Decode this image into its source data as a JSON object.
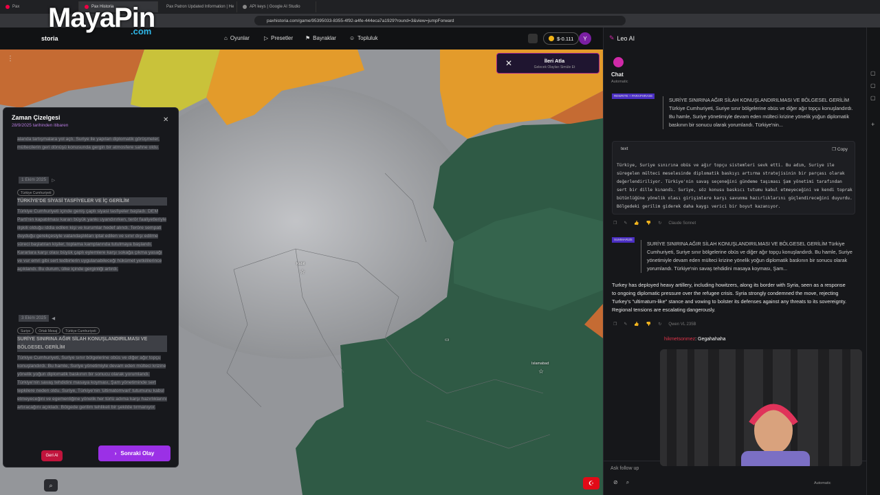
{
  "browser": {
    "tabs": [
      "Pax",
      "Pax Historia",
      "Pax Patron Updated Information | He",
      "API keys | Google AI Studio"
    ],
    "url": "paxhistoria.com/game/95395033-8355-4f92-a4fe-444eca7a1929?round=3&view=jumpForward"
  },
  "header": {
    "brand": "storia",
    "nav": [
      {
        "icon": "gamepad-icon",
        "label": "Oyunlar"
      },
      {
        "icon": "play-icon",
        "label": "Presetler"
      },
      {
        "icon": "flag-icon",
        "label": "Bayraklar"
      },
      {
        "icon": "users-icon",
        "label": "Topluluk"
      }
    ],
    "balance": "$-0.111",
    "avatar": "Y"
  },
  "watermark": {
    "text": "MayaPin",
    "suffix": ".com"
  },
  "toast": {
    "close": "✕",
    "title": "İleri Atla",
    "subtitle": "Gelecek Olayları Simüle Et"
  },
  "map_labels": [
    {
      "text": "Kabil"
    },
    {
      "text": "Islamabad"
    }
  ],
  "timeline": {
    "title": "Zaman Çizelgesi",
    "subtitle": "28/9/2025 tarihinden itibaren",
    "close": "✕",
    "intro_text": "alanda tartışmalara yol açtı. Suriye ile yapılan diplomatik görüşmeler, mültecilerin geri dönüşü konusunda gergin bir atmosfere sahne oldu.",
    "events": [
      {
        "date": "1 Ekim 2025",
        "chips": [
          "Türkiye Cumhuriyeti"
        ],
        "title": "TÜRKİYE'DE SİYASİ TASFİYELER VE İÇ GERİLİM",
        "body": "Türkiye Cumhuriyeti içinde geniş çaplı siyasi tasfiyeler başladı. DEM Parti'nin kapatılması kararı büyük yankı uyandırırken, terör faaliyetleriyle ilişkili olduğu iddia edilen kişi ve kurumlar hedef alındı. Teröre sempati duyduğu gerekçesiyle vatandaşlıkları iptal edilen ve sınır dışı edilme süreci başlatılan kişiler, toplama kamplarında tutulmaya başlandı. Kararlara karşı olası büyük çaplı eylemlere karşı sokağa çıkma yasağı ve vur emri gibi sert tedbirlerin uygulanabileceği hükümet yetkililerince açıklandı. Bu durum, ülke içinde gerginliği artırdı."
      },
      {
        "date": "3 Ekim 2025",
        "chips": [
          "Suriye",
          "Ortak Mesaj",
          "Türkiye Cumhuriyeti"
        ],
        "title": "SURİYE SINIRINA AĞIR SİLAH KONUŞLANDIRILMASI VE BÖLGESEL GERİLİM",
        "body": "Türkiye Cumhuriyeti, Suriye sınır bölgelerine obüs ve diğer ağır topçu konuşlandırdı. Bu hamle, Suriye yönetimiyle devam eden mülteci krizine yönelik yoğun diplomatik baskının bir sonucu olarak yorumlandı. Türkiye'nin savaş tehdidini masaya koyması, Şam yönetiminde sert tepkilere neden oldu. Suriye, Türkiye'nin 'ültimatomvari' tutumunu kabul etmeyeceğini ve egemenliğine yönelik her türlü adıma karşı hazırlıklarını artıracağını açıkladı. Bölgede gerilim tehlikeli bir şekilde tırmanıyor."
      }
    ],
    "prev_label": "Geri Al",
    "next_label": "Sonraki Olay"
  },
  "ai_panel": {
    "title": "Leo AI",
    "chat_label": "Chat",
    "mode": "Automatic",
    "tag1": "REWRITE + PARAPHRASE",
    "quote1": "SURİYE SINIRINA AĞIR SİLAH KONUŞLANDIRILMASI VE BÖLGESEL GERİLİM Türkiye Cumhuriyeti, Suriye sınır bölgelerine obüs ve diğer ağır topçu konuşlandırdı. Bu hamle, Suriye yönetimiyle devam eden mülteci krizine yönelik yoğun diplomatik baskının bir sonucu olarak yorumlandı. Türkiye'nin...",
    "code_header": "text",
    "copy_label": "Copy",
    "code_body": "Türkiye, Suriye sınırına obüs ve ağır topçu sistemleri sevk etti. Bu adım, Suriye ile süregelen mülteci meselesinde diplomatik baskıyı artırma stratejisinin bir parçası olarak değerlendiriliyor. Türkiye'nin savaş seçeneğini gündeme taşıması Şam yönetimi tarafından sert bir dille kınandı. Suriye, söz konusu baskıcı tutumu kabul etmeyeceğini ve kendi toprak bütünlüğüne yönelik olası girişimlere karşı savunma hazırlıklarını güçlendireceğini duyurdu. Bölgedeki gerilim giderek daha kaygı verici bir boyut kazanıyor.",
    "model1": "Claude Sonnet",
    "tag2": "SUMMARIZE",
    "quote2": "SURİYE SINIRINA AĞIR SİLAH KONUŞLANDIRILMASI VE BÖLGESEL GERİLİM Türkiye Cumhuriyeti, Suriye sınır bölgelerine obüs ve diğer ağır topçu konuşlandırdı. Bu hamle, Suriye yönetimiyle devam eden mülteci krizine yönelik yoğun diplomatik baskının bir sonucu olarak yorumlandı. Türkiye'nin savaş tehdidini masaya koyması, Şam...",
    "answer": "Turkey has deployed heavy artillery, including howitzers, along its border with Syria, seen as a response to ongoing diplomatic pressure over the refugee crisis. Syria strongly condemned the move, rejecting Turkey's \"ultimatum-like\" stance and vowing to bolster its defenses against any threats to its sovereignty. Regional tensions are escalating dangerously.",
    "model2": "Qwen VL 235B",
    "ask_placeholder": "Ask follow up",
    "auto_label": "Automatic"
  },
  "stream_chat": {
    "user": "hikmetsonmez",
    "message": ": Gegahahaha"
  },
  "colors": {
    "accent": "#9b30e6",
    "toast_border": "#a3238e",
    "green_region": "#2f5a45",
    "orange_region": "#e39b2b",
    "yellow_region": "#c9c23a"
  }
}
